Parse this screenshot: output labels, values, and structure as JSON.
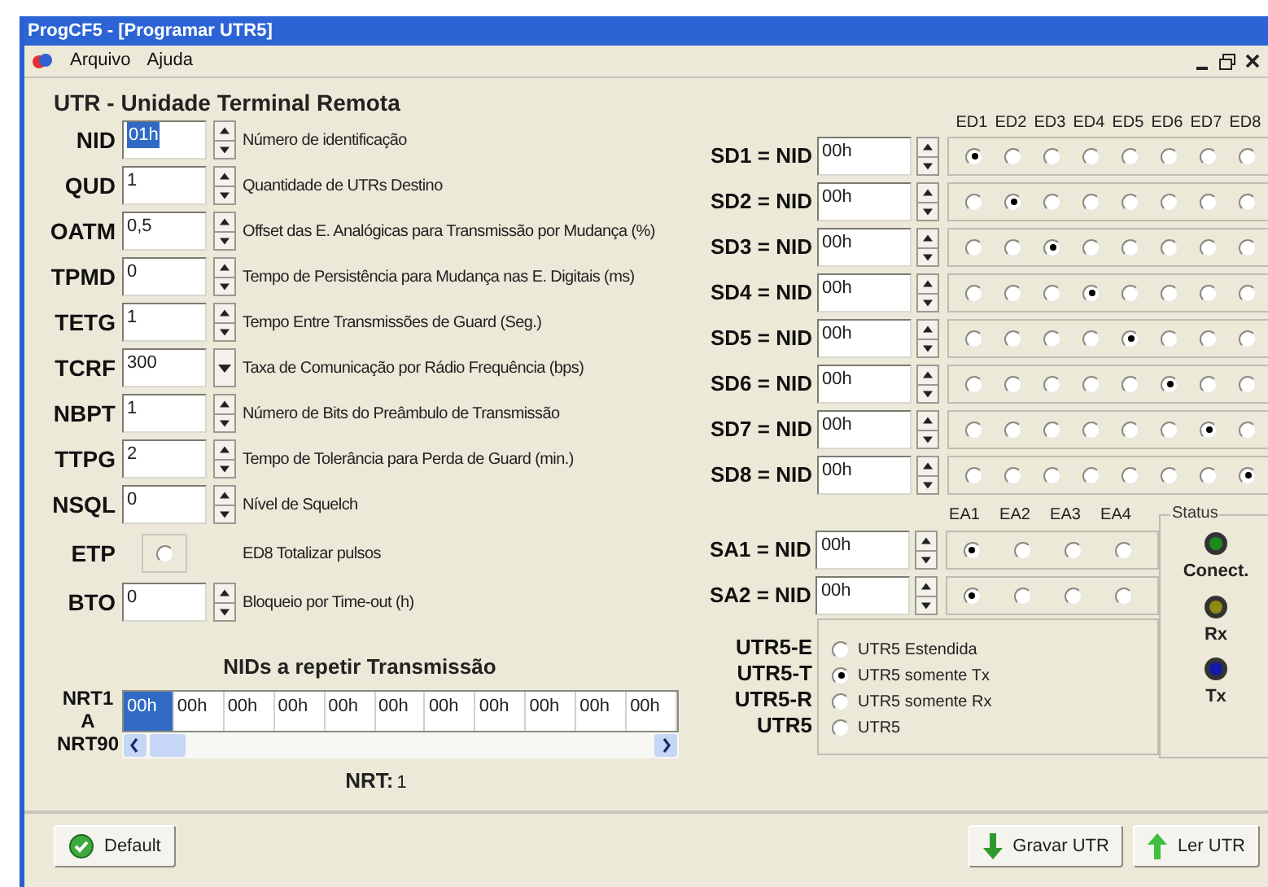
{
  "window": {
    "title": "ProgCF5 - [Programar UTR5]"
  },
  "menu": [
    "Arquivo",
    "Ajuda"
  ],
  "heading": "UTR - Unidade Terminal Remota",
  "params": [
    {
      "label": "NID",
      "kind": "spin",
      "value": "01h",
      "selected": true,
      "description": "Número de identificação"
    },
    {
      "label": "QUD",
      "kind": "spin",
      "value": "1",
      "selected": false,
      "description": "Quantidade de UTRs Destino"
    },
    {
      "label": "OATM",
      "kind": "spin",
      "value": "0,5",
      "selected": false,
      "description": "Offset das E. Analógicas para Transmissão por Mudança (%)"
    },
    {
      "label": "TPMD",
      "kind": "spin",
      "value": "0",
      "selected": false,
      "description": "Tempo de Persistência para Mudança nas E. Digitais (ms)"
    },
    {
      "label": "TETG",
      "kind": "spin",
      "value": "1",
      "selected": false,
      "description": "Tempo Entre Transmissões de Guard (Seg.)"
    },
    {
      "label": "TCRF",
      "kind": "combo",
      "value": "300",
      "selected": false,
      "description": "Taxa de Comunicação por Rádio Frequência (bps)"
    },
    {
      "label": "NBPT",
      "kind": "spin",
      "value": "1",
      "selected": false,
      "description": "Número de Bits do Preâmbulo de Transmissão"
    },
    {
      "label": "TTPG",
      "kind": "spin",
      "value": "2",
      "selected": false,
      "description": "Tempo de Tolerância para Perda de Guard (min.)"
    },
    {
      "label": "NSQL",
      "kind": "spin",
      "value": "0",
      "selected": false,
      "description": "Nível de Squelch"
    },
    {
      "label": "ETP",
      "kind": "radio",
      "checked": false,
      "description": "ED8 Totalizar pulsos"
    },
    {
      "label": "BTO",
      "kind": "spin",
      "value": "0",
      "selected": false,
      "description": "Bloqueio por Time-out (h)"
    }
  ],
  "repeat": {
    "title": "NIDs a repetir Transmissão",
    "row_label": [
      "NRT1",
      "A",
      "NRT90"
    ],
    "cells": [
      {
        "value": "00h",
        "selected": true
      },
      {
        "value": "00h",
        "selected": false
      },
      {
        "value": "00h",
        "selected": false
      },
      {
        "value": "00h",
        "selected": false
      },
      {
        "value": "00h",
        "selected": false
      },
      {
        "value": "00h",
        "selected": false
      },
      {
        "value": "00h",
        "selected": false
      },
      {
        "value": "00h",
        "selected": false
      },
      {
        "value": "00h",
        "selected": false
      },
      {
        "value": "00h",
        "selected": false
      },
      {
        "value": "00h",
        "selected": false
      }
    ],
    "counter_label": "NRT:",
    "counter_value": "1"
  },
  "digital_headers": [
    "ED1",
    "ED2",
    "ED3",
    "ED4",
    "ED5",
    "ED6",
    "ED7",
    "ED8"
  ],
  "digital_outputs": [
    {
      "label": "SD1 = NID",
      "value": "00h",
      "choices": [
        {
          "selected": true
        },
        {
          "selected": false
        },
        {
          "selected": false
        },
        {
          "selected": false
        },
        {
          "selected": false
        },
        {
          "selected": false
        },
        {
          "selected": false
        },
        {
          "selected": false
        }
      ]
    },
    {
      "label": "SD2 = NID",
      "value": "00h",
      "choices": [
        {
          "selected": false
        },
        {
          "selected": true
        },
        {
          "selected": false
        },
        {
          "selected": false
        },
        {
          "selected": false
        },
        {
          "selected": false
        },
        {
          "selected": false
        },
        {
          "selected": false
        }
      ]
    },
    {
      "label": "SD3 = NID",
      "value": "00h",
      "choices": [
        {
          "selected": false
        },
        {
          "selected": false
        },
        {
          "selected": true
        },
        {
          "selected": false
        },
        {
          "selected": false
        },
        {
          "selected": false
        },
        {
          "selected": false
        },
        {
          "selected": false
        }
      ]
    },
    {
      "label": "SD4 = NID",
      "value": "00h",
      "choices": [
        {
          "selected": false
        },
        {
          "selected": false
        },
        {
          "selected": false
        },
        {
          "selected": true
        },
        {
          "selected": false
        },
        {
          "selected": false
        },
        {
          "selected": false
        },
        {
          "selected": false
        }
      ]
    },
    {
      "label": "SD5 = NID",
      "value": "00h",
      "choices": [
        {
          "selected": false
        },
        {
          "selected": false
        },
        {
          "selected": false
        },
        {
          "selected": false
        },
        {
          "selected": true
        },
        {
          "selected": false
        },
        {
          "selected": false
        },
        {
          "selected": false
        }
      ]
    },
    {
      "label": "SD6 = NID",
      "value": "00h",
      "choices": [
        {
          "selected": false
        },
        {
          "selected": false
        },
        {
          "selected": false
        },
        {
          "selected": false
        },
        {
          "selected": false
        },
        {
          "selected": true
        },
        {
          "selected": false
        },
        {
          "selected": false
        }
      ]
    },
    {
      "label": "SD7 = NID",
      "value": "00h",
      "choices": [
        {
          "selected": false
        },
        {
          "selected": false
        },
        {
          "selected": false
        },
        {
          "selected": false
        },
        {
          "selected": false
        },
        {
          "selected": false
        },
        {
          "selected": true
        },
        {
          "selected": false
        }
      ]
    },
    {
      "label": "SD8 = NID",
      "value": "00h",
      "choices": [
        {
          "selected": false
        },
        {
          "selected": false
        },
        {
          "selected": false
        },
        {
          "selected": false
        },
        {
          "selected": false
        },
        {
          "selected": false
        },
        {
          "selected": false
        },
        {
          "selected": true
        }
      ]
    }
  ],
  "analog_headers": [
    "EA1",
    "EA2",
    "EA3",
    "EA4"
  ],
  "analog_outputs": [
    {
      "label": "SA1 = NID",
      "value": "00h",
      "choices": [
        {
          "selected": true
        },
        {
          "selected": false
        },
        {
          "selected": false
        },
        {
          "selected": false
        }
      ]
    },
    {
      "label": "SA2 = NID",
      "value": "00h",
      "choices": [
        {
          "selected": true
        },
        {
          "selected": false
        },
        {
          "selected": false
        },
        {
          "selected": false
        }
      ]
    }
  ],
  "modes": [
    {
      "code": "UTR5-E",
      "label": "UTR5 Estendida",
      "selected": false
    },
    {
      "code": "UTR5-T",
      "label": "UTR5 somente Tx",
      "selected": true
    },
    {
      "code": "UTR5-R",
      "label": "UTR5 somente Rx",
      "selected": false
    },
    {
      "code": "UTR5",
      "label": "UTR5",
      "selected": false
    }
  ],
  "status": {
    "title": "Status",
    "leds": [
      {
        "label": "Conect.",
        "color": "#1e8a1e"
      },
      {
        "label": "Rx",
        "color": "#8c8a10"
      },
      {
        "label": "Tx",
        "color": "#1418a8"
      }
    ]
  },
  "buttons": [
    {
      "label": "Default",
      "kind": "default"
    },
    {
      "label": "Gravar UTR",
      "kind": "write"
    },
    {
      "label": "Ler UTR",
      "kind": "read"
    }
  ]
}
